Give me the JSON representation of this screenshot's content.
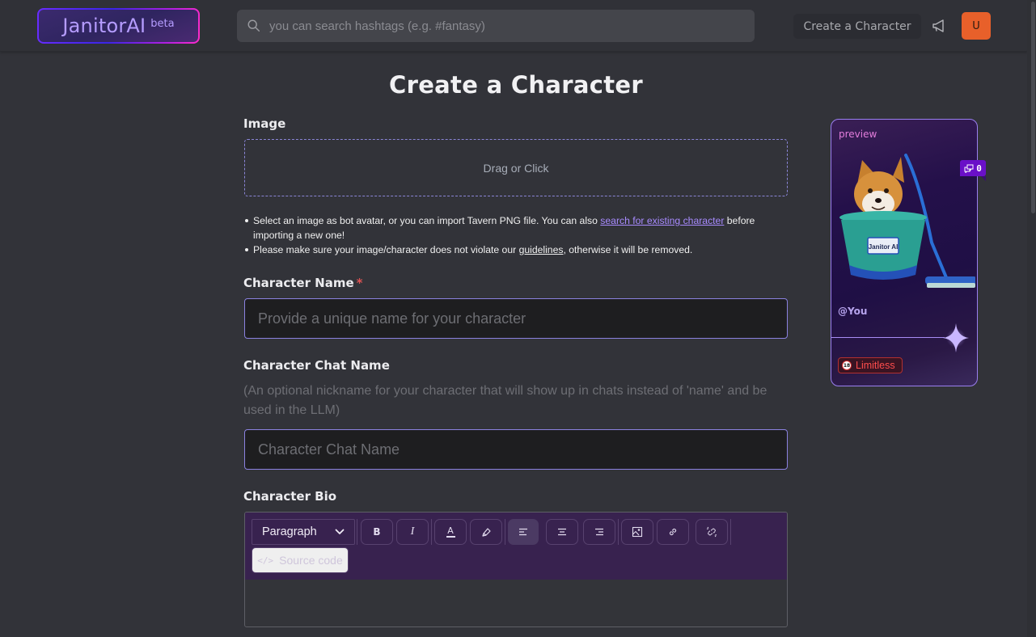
{
  "header": {
    "logo_text": "JanitorAI",
    "logo_badge": "beta",
    "search_placeholder": "you can search hashtags (e.g. #fantasy)",
    "create_button_label": "Create a Character",
    "avatar_initial": "U"
  },
  "page": {
    "title": "Create a Character"
  },
  "image_section": {
    "label": "Image",
    "dropzone_text": "Drag or Click",
    "notes": [
      {
        "before": "Select an image as bot avatar, or you can import Tavern PNG file. You can also ",
        "link": "search for existing character",
        "after": " before importing a new one!"
      },
      {
        "before": "Please make sure your image/character does not violate our ",
        "link": "guidelines",
        "after": ", otherwise it will be removed."
      }
    ]
  },
  "character_name": {
    "label": "Character Name",
    "required_marker": "*",
    "placeholder": "Provide a unique name for your character",
    "value": ""
  },
  "character_chat_name": {
    "label": "Character Chat Name",
    "helper": "(An optional nickname for your character that will show up in chats instead of 'name' and be used in the LLM)",
    "placeholder": "Character Chat Name",
    "value": ""
  },
  "character_bio": {
    "label": "Character Bio",
    "toolbar": {
      "block_format": "Paragraph",
      "bold_label": "B",
      "italic_label": "I",
      "text_color_label": "A",
      "source_code_label": "Source code",
      "active_alignment": "left"
    },
    "content": ""
  },
  "preview_card": {
    "label": "preview",
    "chat_count": "0",
    "image_caption": "Janitor AI",
    "handle": "@You",
    "badge_label": "Limitless",
    "badge_age": "18"
  },
  "colors": {
    "accent": "#8b82e0",
    "link": "#a88bff",
    "toolbar_bg": "#38224f",
    "avatar_bg": "#e8602a",
    "danger": "#ff4d4d"
  }
}
